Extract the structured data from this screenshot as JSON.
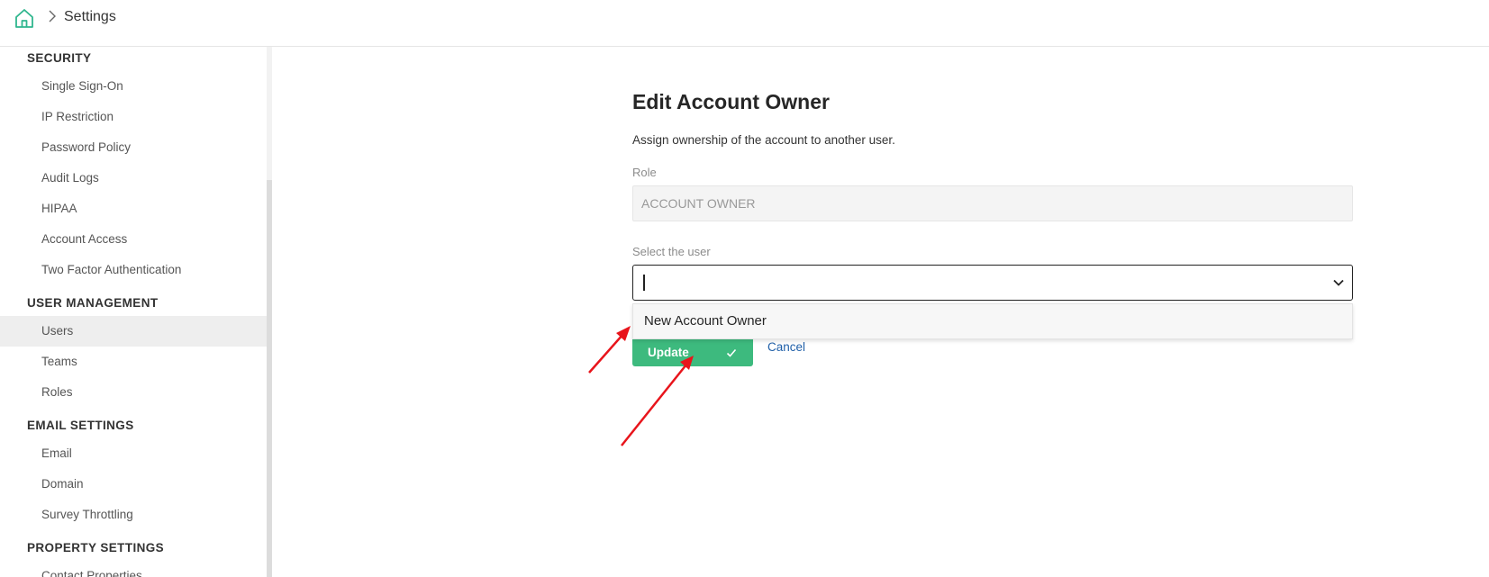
{
  "header": {
    "breadcrumb_title": "Settings",
    "home_icon": "home-icon",
    "separator_icon": "chevron-right-icon"
  },
  "sidebar": {
    "sections": [
      {
        "heading": "SECURITY",
        "items": [
          "Single Sign-On",
          "IP Restriction",
          "Password Policy",
          "Audit Logs",
          "HIPAA",
          "Account Access",
          "Two Factor Authentication"
        ]
      },
      {
        "heading": "USER MANAGEMENT",
        "items": [
          "Users",
          "Teams",
          "Roles"
        ]
      },
      {
        "heading": "EMAIL SETTINGS",
        "items": [
          "Email",
          "Domain",
          "Survey Throttling"
        ]
      },
      {
        "heading": "PROPERTY SETTINGS",
        "items": [
          "Contact Properties"
        ]
      }
    ],
    "active_item": "Users"
  },
  "form": {
    "title": "Edit Account Owner",
    "description": "Assign ownership of the account to another user.",
    "role_label": "Role",
    "role_value": "ACCOUNT OWNER",
    "user_label": "Select the user",
    "user_value": "",
    "dropdown_option": "New Account Owner",
    "update_label": "Update",
    "cancel_label": "Cancel"
  },
  "colors": {
    "accent_green": "#3dba7e",
    "link_blue": "#1f5fa8",
    "home_icon_teal": "#2fb68e",
    "annotation_red": "#e8141b"
  }
}
